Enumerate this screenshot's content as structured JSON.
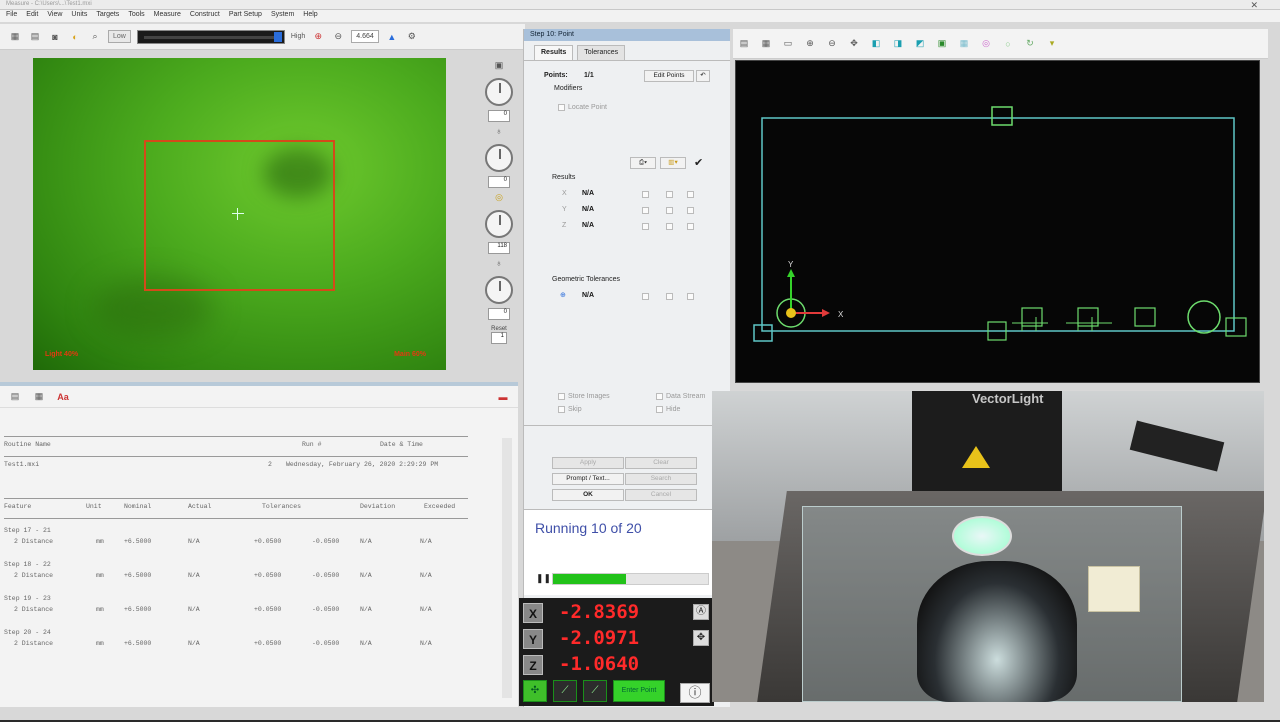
{
  "titlebar": {
    "text": "Measure - C:\\Users\\...\\Test1.mxi"
  },
  "menu": [
    "File",
    "Edit",
    "View",
    "Units",
    "Targets",
    "Tools",
    "Measure",
    "Construct",
    "Part Setup",
    "System",
    "Help"
  ],
  "toolbar": {
    "low_label": "Low",
    "high_label": "High",
    "zoom_value": "4.664"
  },
  "camera": {
    "light_left": "Light 40%",
    "light_right": "Main 60%"
  },
  "side_controls": {
    "values": [
      "0",
      "0",
      "118",
      "0"
    ],
    "reset_label": "Reset",
    "reset_value": "1"
  },
  "report": {
    "header": {
      "routine_name": "Routine Name",
      "run": "Run #",
      "date_time": "Date & Time"
    },
    "routine": {
      "name": "Test1.mxi",
      "run": "2",
      "date": "Wednesday, February 26, 2020 2:29:29 PM"
    },
    "columns": [
      "Feature",
      "Unit",
      "Nominal",
      "Actual",
      "Tolerances",
      "Deviation",
      "Exceeded"
    ],
    "rows": [
      {
        "step": "Step 17 - 21",
        "feature": "2 Distance",
        "unit": "mm",
        "nominal": "+6.5000",
        "actual": "N/A",
        "tol_plus": "+0.0500",
        "tol_minus": "-0.0500",
        "deviation": "N/A",
        "exceeded": "N/A"
      },
      {
        "step": "Step 18 - 22",
        "feature": "2 Distance",
        "unit": "mm",
        "nominal": "+6.5000",
        "actual": "N/A",
        "tol_plus": "+0.0500",
        "tol_minus": "-0.0500",
        "deviation": "N/A",
        "exceeded": "N/A"
      },
      {
        "step": "Step 19 - 23",
        "feature": "2 Distance",
        "unit": "mm",
        "nominal": "+6.5000",
        "actual": "N/A",
        "tol_plus": "+0.0500",
        "tol_minus": "-0.0500",
        "deviation": "N/A",
        "exceeded": "N/A"
      },
      {
        "step": "Step 20 - 24",
        "feature": "2 Distance",
        "unit": "mm",
        "nominal": "+6.5000",
        "actual": "N/A",
        "tol_plus": "+0.0500",
        "tol_minus": "-0.0500",
        "deviation": "N/A",
        "exceeded": "N/A"
      }
    ]
  },
  "step_panel": {
    "header": "Step 10: Point",
    "tabs": [
      "Results",
      "Tolerances"
    ],
    "points_label": "Points:",
    "points_value": "1/1",
    "edit_points": "Edit Points",
    "modifiers": "Modifiers",
    "locate_point": "Locate Point",
    "results_title": "Results",
    "axes": [
      "X",
      "Y",
      "Z"
    ],
    "na": "N/A",
    "geo_tol": "Geometric Tolerances",
    "store_images": "Store Images",
    "skip": "Skip",
    "data_stream": "Data Stream",
    "hide": "Hide",
    "btn_apply": "Apply",
    "btn_clear": "Clear",
    "btn_prompt": "Prompt / Text...",
    "btn_search": "Search",
    "btn_ok": "OK",
    "btn_cancel": "Cancel"
  },
  "run_status": {
    "text": "Running 10 of 20",
    "progress": 0.47
  },
  "dro": {
    "x_label": "X",
    "x_value": "-2.8369",
    "y_label": "Y",
    "y_value": "-2.0971",
    "z_label": "Z",
    "z_value": "-1.0640",
    "enter_point": "Enter Point"
  },
  "cad": {
    "axis_x": "X",
    "axis_y": "Y"
  },
  "photo": {
    "brand": "VectorLight"
  },
  "colors": {
    "dro_red": "#ff2a2a",
    "run_blue": "#3f4fa8",
    "progress_green": "#22c21a",
    "roi_orange": "#d44a1a"
  }
}
